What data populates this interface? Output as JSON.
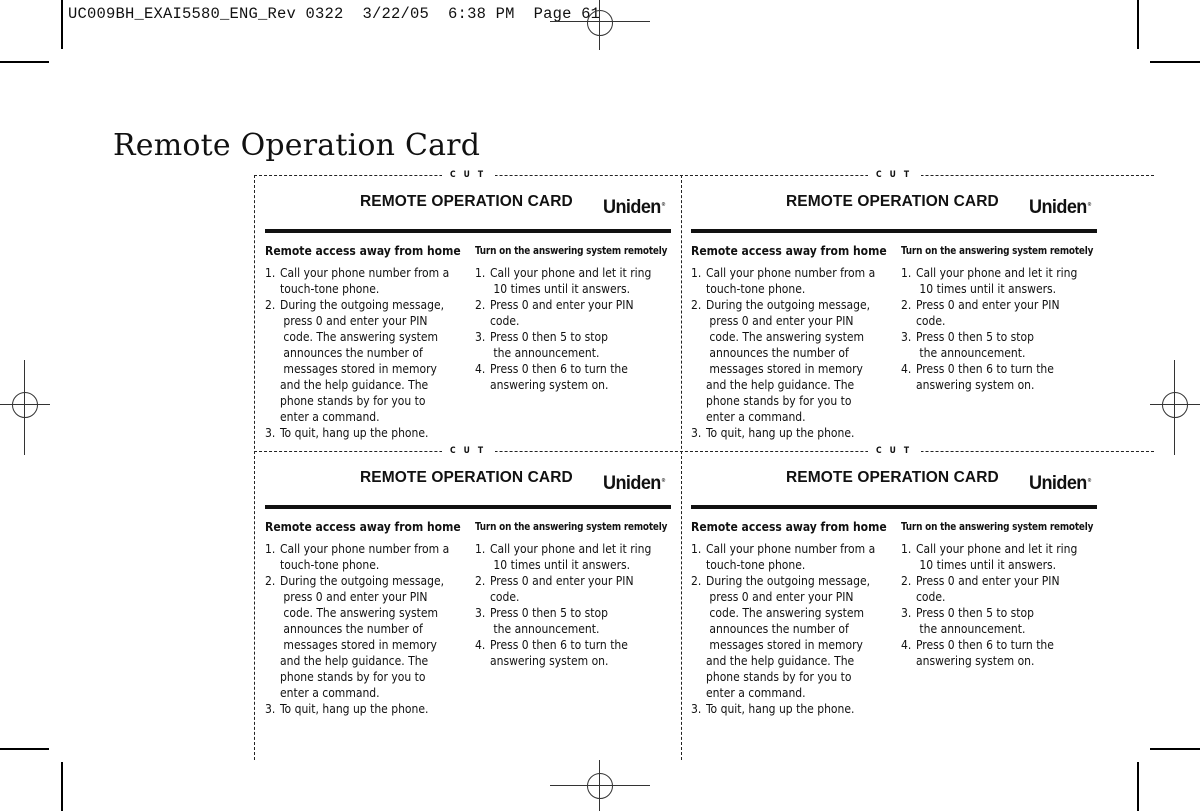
{
  "slug_line": "UC009BH_EXAI5580_ENG_Rev 0322  3/22/05  6:38 PM  Page 61",
  "page_title": "Remote Operation Card",
  "cut_label": "CUT",
  "card": {
    "title": "REMOTE OPERATION CARD",
    "logo": "Uniden",
    "logo_mark": "®",
    "left_column": {
      "heading": "Remote access away from home",
      "steps": [
        {
          "num": "1.",
          "lines": [
            "Call your phone number from a",
            "touch-tone phone."
          ]
        },
        {
          "num": "2.",
          "lines": [
            "During the outgoing message,",
            " press 0 and enter your PIN",
            " code. The answering system",
            " announces the number of",
            " messages stored in memory",
            "and the help guidance. The",
            "phone stands by for you to",
            "enter a command."
          ]
        },
        {
          "num": "3.",
          "lines": [
            "To quit, hang up the phone."
          ]
        }
      ]
    },
    "right_column": {
      "heading": "Turn on the answering system remotely",
      "steps": [
        {
          "num": "1.",
          "lines": [
            "Call your phone and let it ring",
            " 10 times until it answers."
          ]
        },
        {
          "num": "2.",
          "lines": [
            "Press 0 and enter your PIN",
            "code."
          ]
        },
        {
          "num": "3.",
          "lines": [
            "Press 0 then 5 to stop",
            " the announcement."
          ]
        },
        {
          "num": "4.",
          "lines": [
            "Press 0 then 6 to turn the",
            "answering system on."
          ]
        }
      ]
    }
  },
  "card_count": 4
}
